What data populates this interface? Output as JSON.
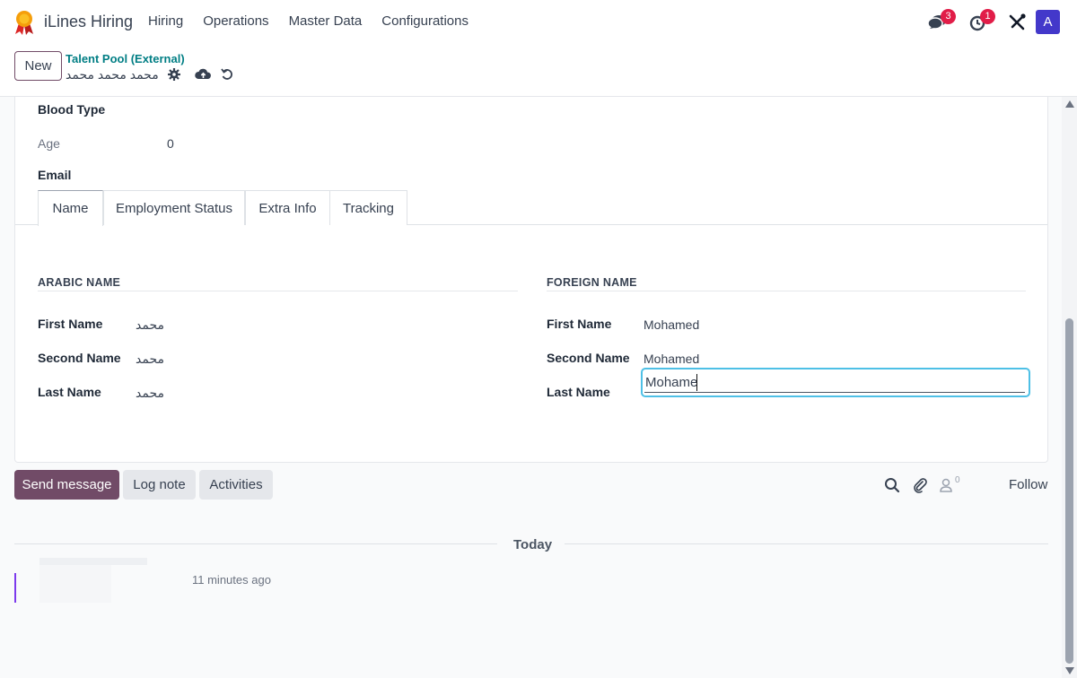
{
  "navbar": {
    "app_name": "iLines Hiring",
    "menu": [
      "Hiring",
      "Operations",
      "Master Data",
      "Configurations"
    ],
    "messages_badge": "3",
    "activities_badge": "1",
    "avatar_letter": "A"
  },
  "control_panel": {
    "new_label": "New",
    "breadcrumb_parent": "Talent Pool (External)",
    "record_name": "محمد محمد محمد"
  },
  "form": {
    "blood_type_label": "Blood Type",
    "age_label": "Age",
    "age_value": "0",
    "email_label": "Email",
    "tabs": [
      "Name",
      "Employment Status",
      "Extra Info",
      "Tracking"
    ],
    "arabic": {
      "title": "ARABIC NAME",
      "first_label": "First Name",
      "first_value": "محمد",
      "second_label": "Second Name",
      "second_value": "محمد",
      "last_label": "Last Name",
      "last_value": "محمد"
    },
    "foreign": {
      "title": "FOREIGN NAME",
      "first_label": "First Name",
      "first_value": "Mohamed",
      "second_label": "Second Name",
      "second_value": "Mohamed",
      "last_label": "Last Name",
      "last_value": "Mohame"
    }
  },
  "chatter": {
    "send_message": "Send message",
    "log_note": "Log note",
    "activities": "Activities",
    "follower_count": "0",
    "follow": "Follow",
    "today": "Today",
    "message_time": "11 minutes ago"
  },
  "colors": {
    "primary": "#714b67",
    "teal": "#017e84",
    "focus": "#4ec0e6",
    "badge": "#e11d48"
  }
}
